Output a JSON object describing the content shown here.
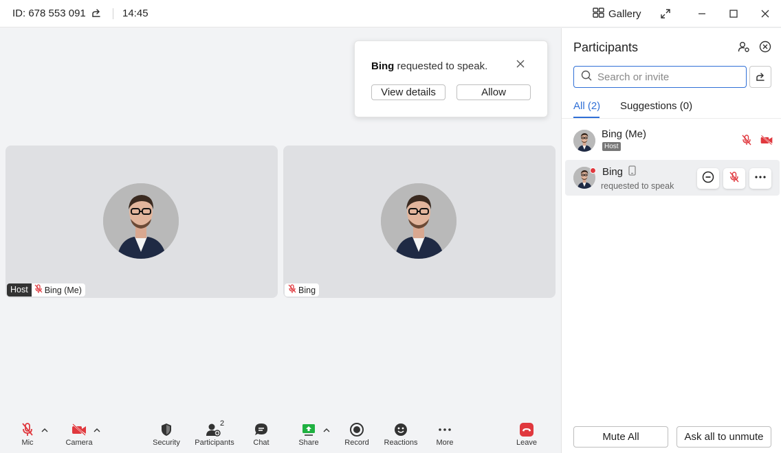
{
  "titlebar": {
    "meeting_id": "ID: 678 553 091",
    "time": "14:45",
    "view_mode": "Gallery"
  },
  "toast": {
    "requester": "Bing",
    "message": " requested to speak.",
    "view_details": "View details",
    "allow": "Allow"
  },
  "tiles": [
    {
      "host_badge": "Host",
      "name": "Bing (Me)"
    },
    {
      "name": "Bing"
    }
  ],
  "toolbar": {
    "mic": "Mic",
    "camera": "Camera",
    "security": "Security",
    "participants": "Participants",
    "participants_count": "2",
    "chat": "Chat",
    "share": "Share",
    "record": "Record",
    "reactions": "Reactions",
    "more": "More",
    "leave": "Leave"
  },
  "sidebar": {
    "title": "Participants",
    "search_placeholder": "Search or invite",
    "tabs": [
      {
        "label": "All (2)"
      },
      {
        "label": "Suggestions (0)"
      }
    ],
    "participants": [
      {
        "name": "Bing (Me)",
        "badge": "Host"
      },
      {
        "name": "Bing",
        "status": "requested to speak"
      }
    ],
    "mute_all": "Mute All",
    "ask_unmute": "Ask all to unmute"
  },
  "colors": {
    "accent": "#2f6fd6",
    "danger": "#e0383e",
    "share_green": "#1fb141"
  }
}
